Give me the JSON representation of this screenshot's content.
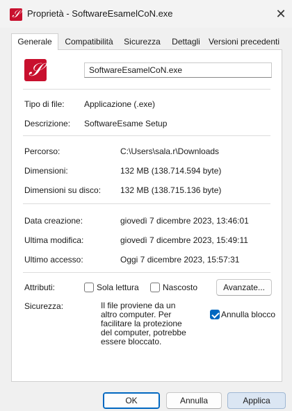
{
  "window": {
    "title": "Proprietà - SoftwareEsamelCoN.exe",
    "close_glyph": "✕",
    "icon": "app-file-icon"
  },
  "tabs": [
    {
      "label": "Generale",
      "active": true
    },
    {
      "label": "Compatibilità",
      "active": false
    },
    {
      "label": "Sicurezza",
      "active": false
    },
    {
      "label": "Dettagli",
      "active": false
    },
    {
      "label": "Versioni precedenti",
      "active": false
    }
  ],
  "general": {
    "file_name": "SoftwareEsamelCoN.exe",
    "rows": [
      {
        "label": "Tipo di file:",
        "value": "Applicazione (.exe)"
      },
      {
        "label": "Descrizione:",
        "value": "SoftwareEsame Setup"
      },
      {
        "label": "Percorso:",
        "value": "C:\\Users\\sala.r\\Downloads"
      },
      {
        "label": "Dimensioni:",
        "value": "132 MB (138.714.594 byte)"
      },
      {
        "label": "Dimensioni su disco:",
        "value": "132 MB (138.715.136 byte)"
      },
      {
        "label": "Data creazione:",
        "value": "giovedì 7 dicembre 2023, 13:46:01"
      },
      {
        "label": "Ultima modifica:",
        "value": "giovedì 7 dicembre 2023, 15:49:11"
      },
      {
        "label": "Ultimo accesso:",
        "value": "Oggi 7 dicembre 2023, 15:57:31"
      }
    ],
    "attributes": {
      "label": "Attributi:",
      "readonly_label": "Sola lettura",
      "readonly_checked": false,
      "hidden_label": "Nascosto",
      "hidden_checked": false,
      "advanced_label": "Avanzate..."
    },
    "security": {
      "label": "Sicurezza:",
      "text": "Il file proviene da un altro computer. Per facilitare la protezione del computer, potrebbe essere bloccato.",
      "unblock_label": "Annulla blocco",
      "unblock_checked": true
    }
  },
  "buttons": {
    "ok": "OK",
    "cancel": "Annulla",
    "apply": "Applica"
  },
  "colors": {
    "accent": "#0067c0",
    "icon_red": "#c8102e"
  }
}
